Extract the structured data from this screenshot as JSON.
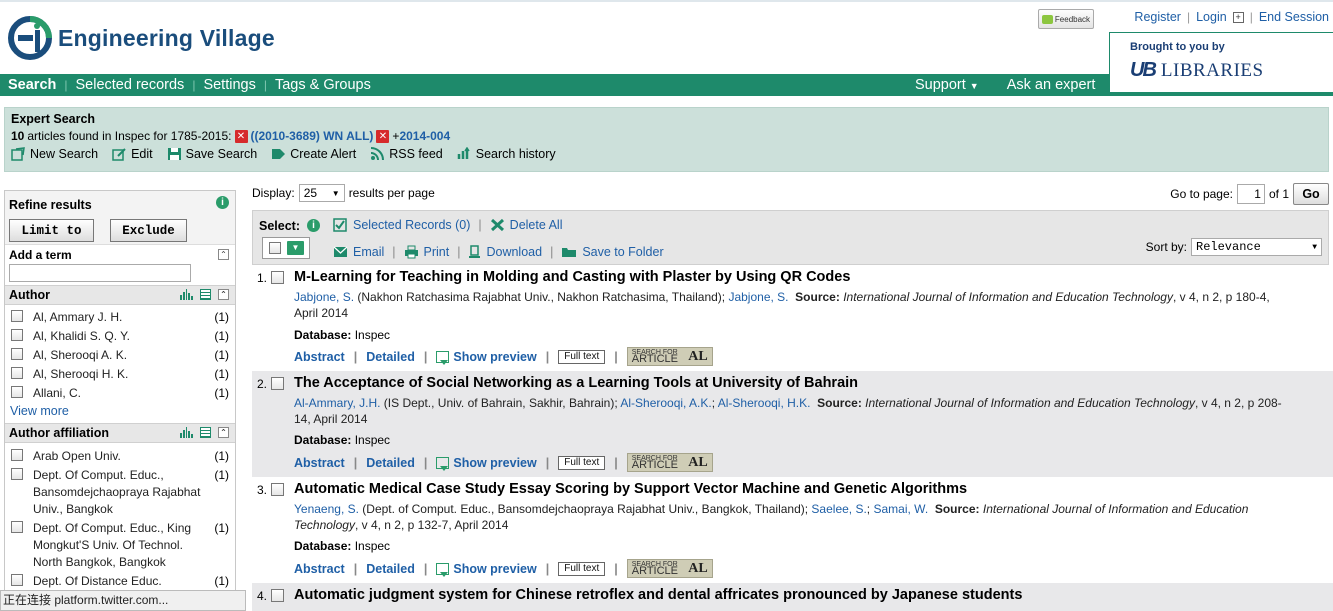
{
  "header": {
    "app_name": "Engineering Village",
    "feedback_label": "Feedback",
    "top_links": [
      "Register",
      "Login",
      "End Session"
    ],
    "brought_by": "Brought to you by",
    "library_mark": "UB",
    "library_name": "LIBRARIES"
  },
  "nav": {
    "items": [
      "Search",
      "Selected records",
      "Settings",
      "Tags & Groups"
    ],
    "right_items": [
      "Support",
      "Ask an expert"
    ]
  },
  "expert": {
    "title": "Expert Search",
    "count": "10",
    "summary": "articles found in Inspec for 1785-2015:",
    "query1": "((2010-3689) WN ALL)",
    "query2_prefix": "+",
    "query2": "2014-004",
    "tools": [
      "New Search",
      "Edit",
      "Save Search",
      "Create Alert",
      "RSS feed",
      "Search history"
    ]
  },
  "sidebar": {
    "refine_title": "Refine results",
    "limit_label": "Limit to",
    "exclude_label": "Exclude",
    "add_term_label": "Add a term",
    "author_title": "Author",
    "authors": [
      {
        "name": "Al, Ammary J. H.",
        "count": "(1)"
      },
      {
        "name": "Al, Khalidi S. Q. Y.",
        "count": "(1)"
      },
      {
        "name": "Al, Sherooqi A. K.",
        "count": "(1)"
      },
      {
        "name": "Al, Sherooqi H. K.",
        "count": "(1)"
      },
      {
        "name": "Allani, C.",
        "count": "(1)"
      }
    ],
    "view_more": "View more",
    "affiliation_title": "Author affiliation",
    "affiliations": [
      {
        "name": "Arab Open Univ.",
        "count": "(1)"
      },
      {
        "name": "Dept. Of Comput. Educ., Bansomdejchaopraya Rajabhat Univ., Bangkok",
        "count": "(1)"
      },
      {
        "name": "Dept. Of Comput. Educ., King Mongkut'S Univ. Of Technol. North Bangkok, Bangkok",
        "count": "(1)"
      },
      {
        "name": "Dept. Of Distance Educ.",
        "count": "(1)"
      }
    ]
  },
  "results_controls": {
    "display_label": "Display:",
    "display_value": "25",
    "per_page_label": "results per page",
    "goto_label": "Go to page:",
    "page_value": "1",
    "of_label": "of 1",
    "go_label": "Go",
    "select_label": "Select:",
    "selected_records": "Selected Records (0)",
    "delete_all": "Delete All",
    "email": "Email",
    "print": "Print",
    "download": "Download",
    "save_to_folder": "Save to Folder",
    "sort_label": "Sort by:",
    "sort_value": "Relevance"
  },
  "results": [
    {
      "num": "1.",
      "title": "M-Learning for Teaching in Molding and Casting with Plaster by Using QR Codes",
      "author1": "Jabjone, S.",
      "affil": " (Nakhon Ratchasima Rajabhat Univ., Nakhon Ratchasima, Thailand); ",
      "author2": "Jabjone, S.",
      "source_label": "Source:",
      "journal": "International Journal of Information and Education Technology",
      "details": ", v 4, n 2, p 180-4, April 2014",
      "db_label": "Database:",
      "db": "Inspec"
    },
    {
      "num": "2.",
      "title": "The Acceptance of Social Networking as a Learning Tools at University of Bahrain",
      "author1": "Al-Ammary, J.H.",
      "affil": " (IS Dept., Univ. of Bahrain, Sakhir, Bahrain); ",
      "author2": "Al-Sherooqi, A.K.",
      "author3": "Al-Sherooqi, H.K.",
      "source_label": "Source:",
      "journal": "International Journal of Information and Education Technology",
      "details": ", v 4, n 2, p 208-14, April 2014",
      "db_label": "Database:",
      "db": "Inspec"
    },
    {
      "num": "3.",
      "title": "Automatic Medical Case Study Essay Scoring by Support Vector Machine and Genetic Algorithms",
      "author1": "Yenaeng, S.",
      "affil": " (Dept. of Comput. Educ., Bansomdejchaopraya Rajabhat Univ., Bangkok, Thailand); ",
      "author2": "Saelee, S.",
      "author3": "Samai, W.",
      "source_label": "Source:",
      "journal": "International Journal of Information and Education Technology",
      "details": ", v 4, n 2, p 132-7, April 2014",
      "db_label": "Database:",
      "db": "Inspec"
    },
    {
      "num": "4.",
      "title": "Automatic judgment system for Chinese retroflex and dental affricates pronounced by Japanese students"
    }
  ],
  "result_links": {
    "abstract": "Abstract",
    "detailed": "Detailed",
    "show_preview": "Show preview",
    "full_text": "Full text",
    "sfa_line1": "SEARCH FOR",
    "sfa_line2": "ARTICLE",
    "sfa_mark": "AL"
  },
  "status_bar": "正在连接 platform.twitter.com...",
  "colors": {
    "nav_green": "#1e8a6b",
    "band": "#cce0da",
    "link": "#1f5fa6"
  }
}
